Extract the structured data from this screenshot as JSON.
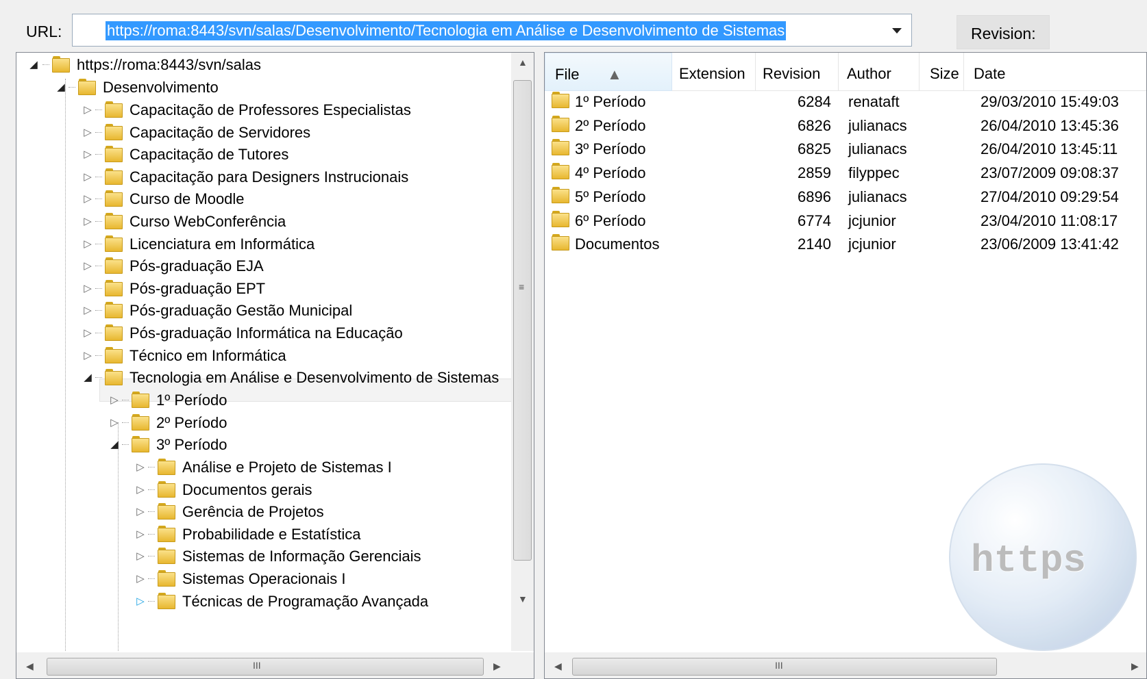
{
  "toolbar": {
    "url_label": "URL:",
    "url_value": "https://roma:8443/svn/salas/Desenvolvimento/Tecnologia em Análise e Desenvolvimento de Sistemas",
    "revision_label": "Revision:"
  },
  "tree": {
    "root": "https://roma:8443/svn/salas",
    "desenvolvimento": "Desenvolvimento",
    "courses": [
      "Capacitação de Professores Especialistas",
      "Capacitação de Servidores",
      "Capacitação de Tutores",
      "Capacitação para Designers Instrucionais",
      "Curso de Moodle",
      "Curso WebConferência",
      "Licenciatura em Informática",
      "Pós-graduação EJA",
      "Pós-graduação EPT",
      "Pós-graduação Gestão Municipal",
      "Pós-graduação Informática na Educação",
      "Técnico em Informática",
      "Tecnologia em Análise e Desenvolvimento de Sistemas"
    ],
    "periods": [
      "1º Período",
      "2º Período",
      "3º Período"
    ],
    "subjects": [
      "Análise e Projeto de Sistemas I",
      "Documentos gerais",
      "Gerência de Projetos",
      "Probabilidade e Estatística",
      "Sistemas de Informação Gerenciais",
      "Sistemas Operacionais I",
      "Técnicas de Programação Avançada"
    ],
    "scroll_grip": "≡",
    "hscroll_grip": "III"
  },
  "list": {
    "columns": [
      "File",
      "Extension",
      "Revision",
      "Author",
      "Size",
      "Date"
    ],
    "rows": [
      {
        "file": "1º Período",
        "extension": "",
        "revision": "6284",
        "author": "renataft",
        "size": "",
        "date": "29/03/2010 15:49:03"
      },
      {
        "file": "2º Período",
        "extension": "",
        "revision": "6826",
        "author": "julianacs",
        "size": "",
        "date": "26/04/2010 13:45:36"
      },
      {
        "file": "3º Período",
        "extension": "",
        "revision": "6825",
        "author": "julianacs",
        "size": "",
        "date": "26/04/2010 13:45:11"
      },
      {
        "file": "4º Período",
        "extension": "",
        "revision": "2859",
        "author": "filyppec",
        "size": "",
        "date": "23/07/2009 09:08:37"
      },
      {
        "file": "5º Período",
        "extension": "",
        "revision": "6896",
        "author": "julianacs",
        "size": "",
        "date": "27/04/2010 09:29:54"
      },
      {
        "file": "6º Período",
        "extension": "",
        "revision": "6774",
        "author": "jcjunior",
        "size": "",
        "date": "23/04/2010 11:08:17"
      },
      {
        "file": "Documentos",
        "extension": "",
        "revision": "2140",
        "author": "jcjunior",
        "size": "",
        "date": "23/06/2009 13:41:42"
      }
    ],
    "watermark": "https",
    "hscroll_grip": "III"
  }
}
